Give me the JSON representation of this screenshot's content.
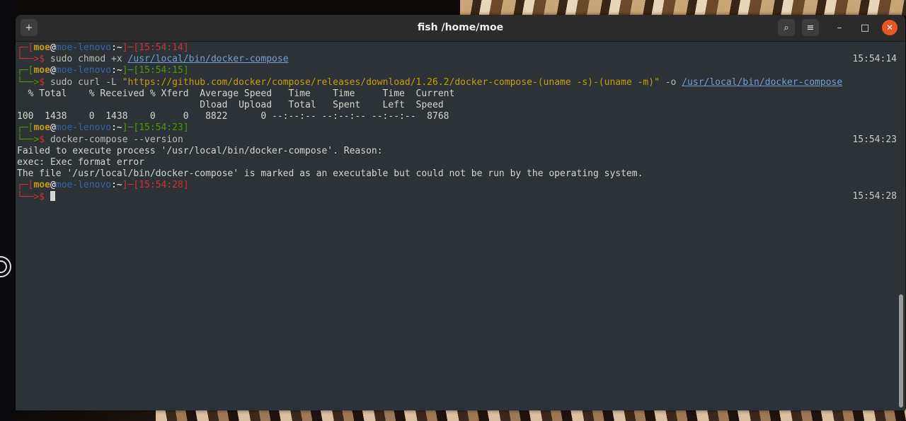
{
  "window": {
    "title": "fish /home/moe",
    "buttons": {
      "new_tab": "+",
      "search": "⌕",
      "menu": "≡",
      "minimize": "–",
      "maximize": "□",
      "close": "✕"
    }
  },
  "prompt": {
    "user": "moe",
    "at": "@",
    "host": "moe-lenovo",
    "dir": ":~",
    "lbracket": "[",
    "rbracket": "]",
    "corner_top": "┌─",
    "corner_bottom": "└──",
    "arrow": ">",
    "dollar": "$",
    "dash": "─"
  },
  "blocks": [
    {
      "time": "15:54:14",
      "command": "sudo chmod +x ",
      "command_path": "/usr/local/bin/docker-compose",
      "right_time": "15:54:14"
    },
    {
      "time": "15:54:15",
      "command": "sudo curl -L ",
      "command_string": "\"https://github.com/docker/compose/releases/download/1.26.2/docker-compose-(uname -s)-(uname -m)\"",
      "command_flag": " -o ",
      "command_path": "/usr/local/bin/docker-compose",
      "output": [
        "  % Total    % Received % Xferd  Average Speed   Time    Time     Time  Current",
        "                                 Dload  Upload   Total   Spent    Left  Speed",
        "100  1438    0  1438    0     0   8822      0 --:--:-- --:--:-- --:--:--  8768"
      ]
    },
    {
      "time": "15:54:23",
      "command": "docker-compose --version",
      "right_time": "15:54:23",
      "output": [
        "Failed to execute process '/usr/local/bin/docker-compose'. Reason:",
        "exec: Exec format error",
        "The file '/usr/local/bin/docker-compose' is marked as an executable but could not be run by the operating system."
      ]
    },
    {
      "time": "15:54:28",
      "right_time": "15:54:28"
    }
  ]
}
